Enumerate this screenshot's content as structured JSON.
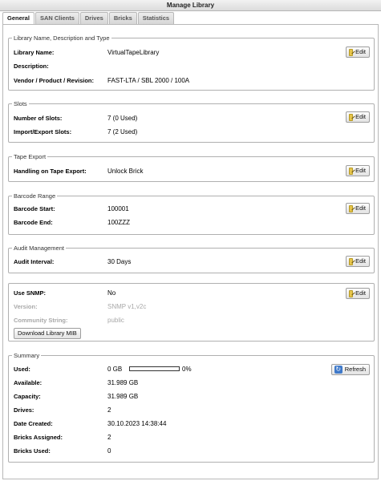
{
  "window": {
    "title": "Manage Library"
  },
  "tabs": [
    {
      "label": "General",
      "active": true
    },
    {
      "label": "SAN Clients",
      "active": false
    },
    {
      "label": "Drives",
      "active": false
    },
    {
      "label": "Bricks",
      "active": false
    },
    {
      "label": "Statistics",
      "active": false
    }
  ],
  "library": {
    "legend": "Library Name, Description and Type",
    "name_label": "Library Name:",
    "name_value": "VirtualTapeLibrary",
    "description_label": "Description:",
    "description_value": "",
    "vendor_label": "Vendor / Product / Revision:",
    "vendor_value": "FAST-LTA / SBL 2000 / 100A",
    "edit_label": "Edit"
  },
  "slots": {
    "legend": "Slots",
    "number_label": "Number of Slots:",
    "number_value": "7 (0 Used)",
    "import_label": "Import/Export Slots:",
    "import_value": "7 (2 Used)",
    "edit_label": "Edit"
  },
  "tape_export": {
    "legend": "Tape Export",
    "handling_label": "Handling on Tape Export:",
    "handling_value": "Unlock Brick",
    "edit_label": "Edit"
  },
  "barcode": {
    "legend": "Barcode Range",
    "start_label": "Barcode Start:",
    "start_value": "100001",
    "end_label": "Barcode End:",
    "end_value": "100ZZZ",
    "edit_label": "Edit"
  },
  "audit": {
    "legend": "Audit Management",
    "interval_label": "Audit Interval:",
    "interval_value": "30 Days",
    "edit_label": "Edit"
  },
  "snmp": {
    "use_label": "Use SNMP:",
    "use_value": "No",
    "version_label": "Version:",
    "version_value": "SNMP v1,v2c",
    "community_label": "Community String:",
    "community_value": "public",
    "download_label": "Download Library MIB",
    "edit_label": "Edit"
  },
  "summary": {
    "legend": "Summary",
    "used_label": "Used:",
    "used_value": "0 GB",
    "used_percent_text": "0%",
    "used_fraction": 0,
    "available_label": "Available:",
    "available_value": "31.989 GB",
    "capacity_label": "Capacity:",
    "capacity_value": "31.989 GB",
    "drives_label": "Drives:",
    "drives_value": "2",
    "date_label": "Date Created:",
    "date_value": "30.10.2023 14:38:44",
    "bricks_assigned_label": "Bricks Assigned:",
    "bricks_assigned_value": "2",
    "bricks_used_label": "Bricks Used:",
    "bricks_used_value": "0",
    "refresh_label": "Refresh"
  },
  "icons": {
    "edit": "pencil-icon",
    "refresh": "refresh-icon"
  }
}
